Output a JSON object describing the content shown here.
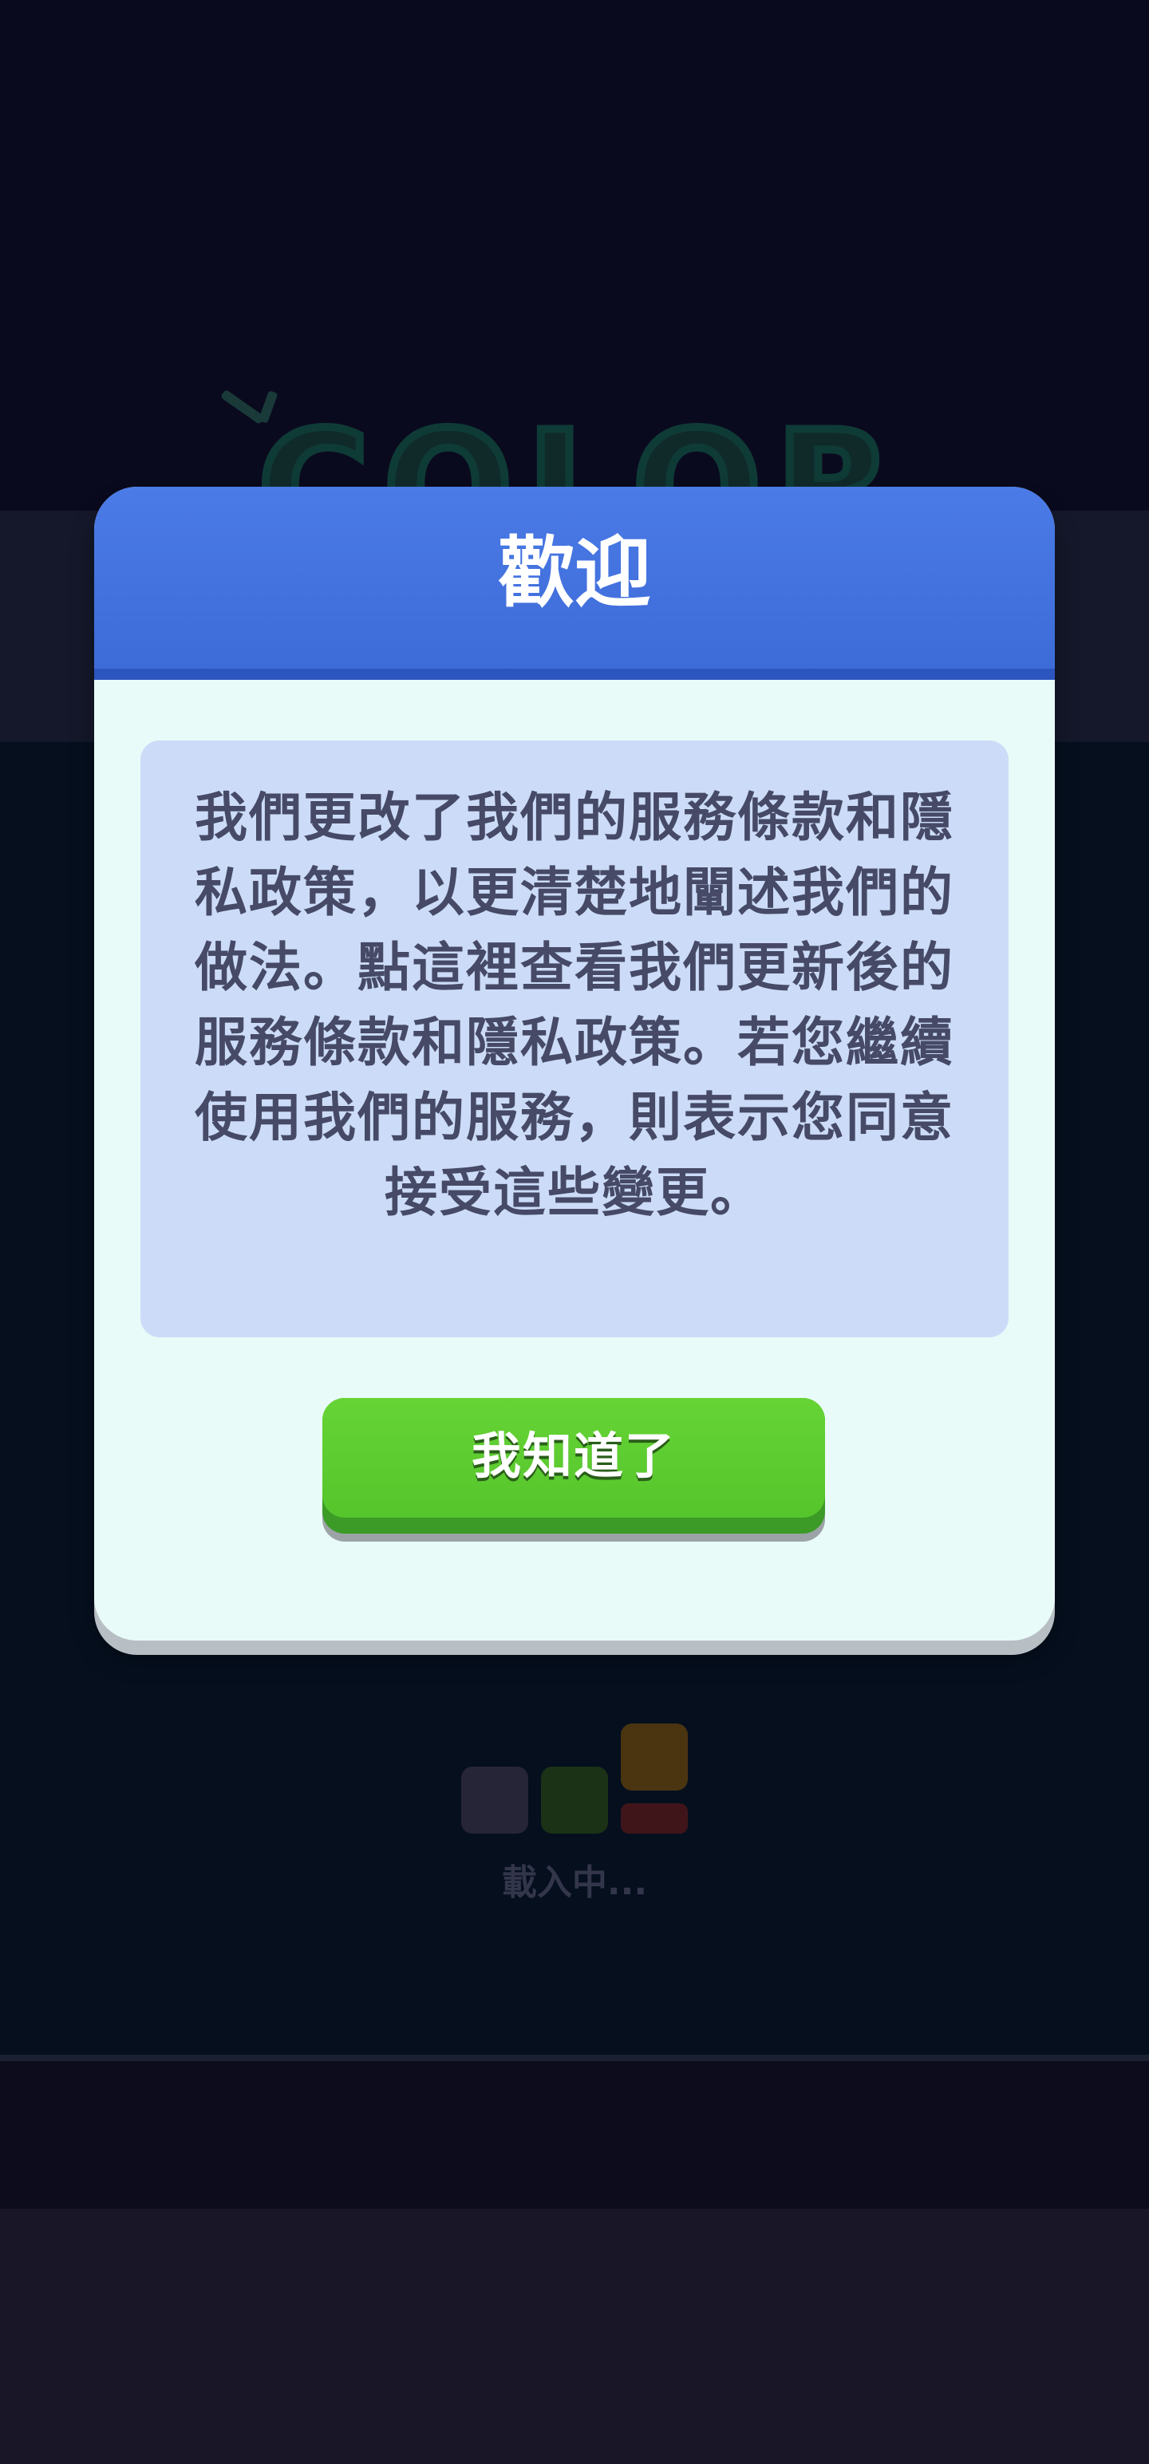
{
  "background_logo": {
    "text": "COLOR"
  },
  "dialog": {
    "title": "歡迎",
    "message": "我們更改了我們的服務條款和隱私政策，以更清楚地闡述我們的做法。點這裡查看我們更新後的服務條款和隱私政策。若您繼續使用我們的服務，則表示您同意接受這些變更。",
    "confirm_label": "我知道了"
  },
  "loading": {
    "label": "載入中..."
  },
  "colors": {
    "header_blue": "#4b7be6",
    "button_green": "#5bc930",
    "message_box": "#ccdcf8",
    "dialog_body": "#e9fbf8"
  }
}
